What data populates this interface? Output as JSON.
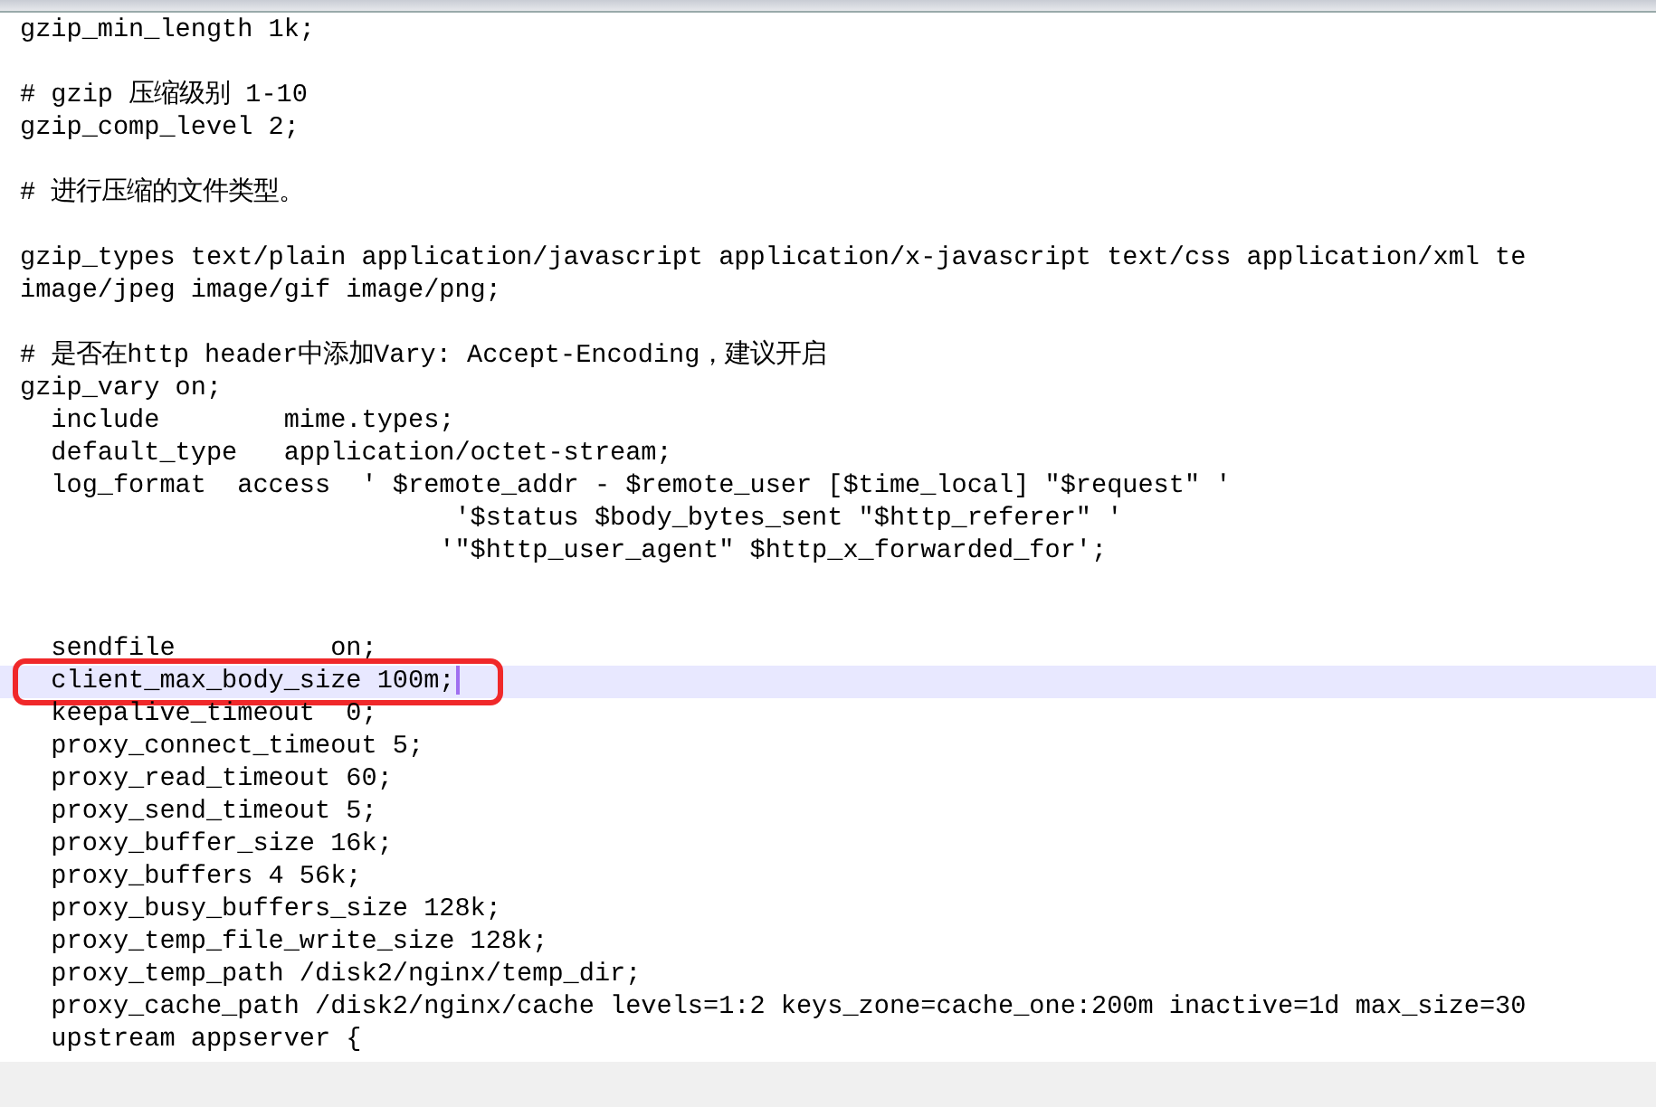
{
  "editor": {
    "lines": [
      {
        "kind": "code",
        "text": "gzip_min_length 1k;",
        "current": false
      },
      {
        "kind": "blank"
      },
      {
        "kind": "code",
        "text": "# gzip 压缩级别 1-10",
        "current": false
      },
      {
        "kind": "code",
        "text": "gzip_comp_level 2;",
        "current": false
      },
      {
        "kind": "blank"
      },
      {
        "kind": "code",
        "text": "# 进行压缩的文件类型。",
        "current": false
      },
      {
        "kind": "blank"
      },
      {
        "kind": "code",
        "text": "gzip_types text/plain application/javascript application/x-javascript text/css application/xml te",
        "current": false
      },
      {
        "kind": "code",
        "text": "image/jpeg image/gif image/png;",
        "current": false
      },
      {
        "kind": "blank"
      },
      {
        "kind": "code",
        "text": "# 是否在http header中添加Vary: Accept-Encoding，建议开启",
        "current": false
      },
      {
        "kind": "code",
        "text": "gzip_vary on;",
        "current": false
      },
      {
        "kind": "code",
        "text": "  include        mime.types;",
        "current": false
      },
      {
        "kind": "code",
        "text": "  default_type   application/octet-stream;",
        "current": false
      },
      {
        "kind": "code",
        "text": "  log_format  access  ' $remote_addr - $remote_user [$time_local] \"$request\" '",
        "current": false
      },
      {
        "kind": "code",
        "text": "                            '$status $body_bytes_sent \"$http_referer\" '",
        "current": false
      },
      {
        "kind": "code",
        "text": "                           '\"$http_user_agent\" $http_x_forwarded_for';",
        "current": false
      },
      {
        "kind": "blank"
      },
      {
        "kind": "blank"
      },
      {
        "kind": "code",
        "text": "  sendfile          on;",
        "current": false
      },
      {
        "kind": "code",
        "text": "  client_max_body_size 100m;",
        "current": true,
        "marked": true
      },
      {
        "kind": "code",
        "text": "  keepalive_timeout  0;",
        "current": false
      },
      {
        "kind": "code",
        "text": "  proxy_connect_timeout 5;",
        "current": false
      },
      {
        "kind": "code",
        "text": "  proxy_read_timeout 60;",
        "current": false
      },
      {
        "kind": "code",
        "text": "  proxy_send_timeout 5;",
        "current": false
      },
      {
        "kind": "code",
        "text": "  proxy_buffer_size 16k;",
        "current": false
      },
      {
        "kind": "code",
        "text": "  proxy_buffers 4 56k;",
        "current": false
      },
      {
        "kind": "code",
        "text": "  proxy_busy_buffers_size 128k;",
        "current": false
      },
      {
        "kind": "code",
        "text": "  proxy_temp_file_write_size 128k;",
        "current": false
      },
      {
        "kind": "code",
        "text": "  proxy_temp_path /disk2/nginx/temp_dir;",
        "current": false
      },
      {
        "kind": "code",
        "text": "  proxy_cache_path /disk2/nginx/cache levels=1:2 keys_zone=cache_one:200m inactive=1d max_size=30",
        "current": false
      },
      {
        "kind": "code",
        "text": "  upstream appserver {",
        "current": false
      }
    ]
  }
}
